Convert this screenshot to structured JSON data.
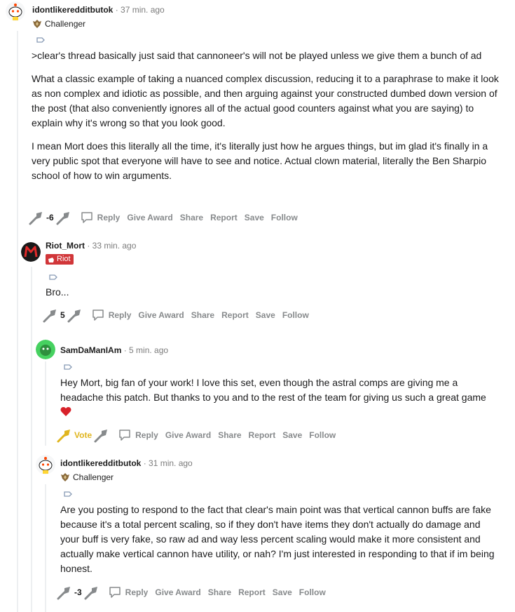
{
  "comments": [
    {
      "user": "idontlikeredditbutok",
      "time": "· 37 min. ago",
      "flair": "Challenger",
      "paragraphs": [
        ">clear's thread basically just said that cannoneer's will not be played unless we give them a bunch of ad",
        "What a classic example of taking a nuanced complex discussion, reducing it to a paraphrase to make it look as non complex and idiotic as possible, and then arguing against your constructed dumbed down version of the post (that also conveniently ignores all of the actual good counters against what you are saying) to explain why it's wrong so that you look good.",
        "I mean Mort does this literally all the time, it's literally just how he argues things, but im glad it's finally in a very public spot that everyone will have to see and notice. Actual clown material, literally the Ben Sharpio school of how to win arguments."
      ],
      "votes": "-6"
    },
    {
      "user": "Riot_Mort",
      "time": "· 33 min. ago",
      "flair": "Riot",
      "paragraphs": [
        "Bro..."
      ],
      "votes": "5"
    },
    {
      "user": "SamDaManIAm",
      "time": "· 5 min. ago",
      "flair": "",
      "paragraphs": [
        "Hey Mort, big fan of your work! I love this set, even though the astral comps are giving me a headache this patch. But thanks to you and to the rest of the team for giving us such a great game"
      ],
      "votes": "Vote"
    },
    {
      "user": "idontlikeredditbutok",
      "time": "· 31 min. ago",
      "flair": "Challenger",
      "paragraphs": [
        "Are you posting to respond to the fact that clear's main point was that vertical cannon buffs are fake because it's a total percent scaling, so if they don't have items they don't actually do damage and your buff is very fake, so raw ad and way less percent scaling would make it more consistent and actually make vertical cannon have utility, or nah? I'm just interested in responding to that if im being honest."
      ],
      "votes": "-3"
    }
  ],
  "actions": {
    "reply": "Reply",
    "give_award": "Give Award",
    "share": "Share",
    "report": "Report",
    "save": "Save",
    "follow": "Follow"
  },
  "colors": {
    "meta": "#7c7c7c",
    "action": "#878a8c",
    "riot_red": "#d13639",
    "thread_line": "#edeff1",
    "vote_gold": "#e0b51e"
  },
  "icons": [
    "snoo-avatar-icon",
    "riot-avatar-icon",
    "green-avatar-icon",
    "challenger-flair-icon",
    "tag-icon",
    "upvote-icon",
    "downvote-icon",
    "reply-bubble-icon",
    "heart-emoji-icon"
  ]
}
